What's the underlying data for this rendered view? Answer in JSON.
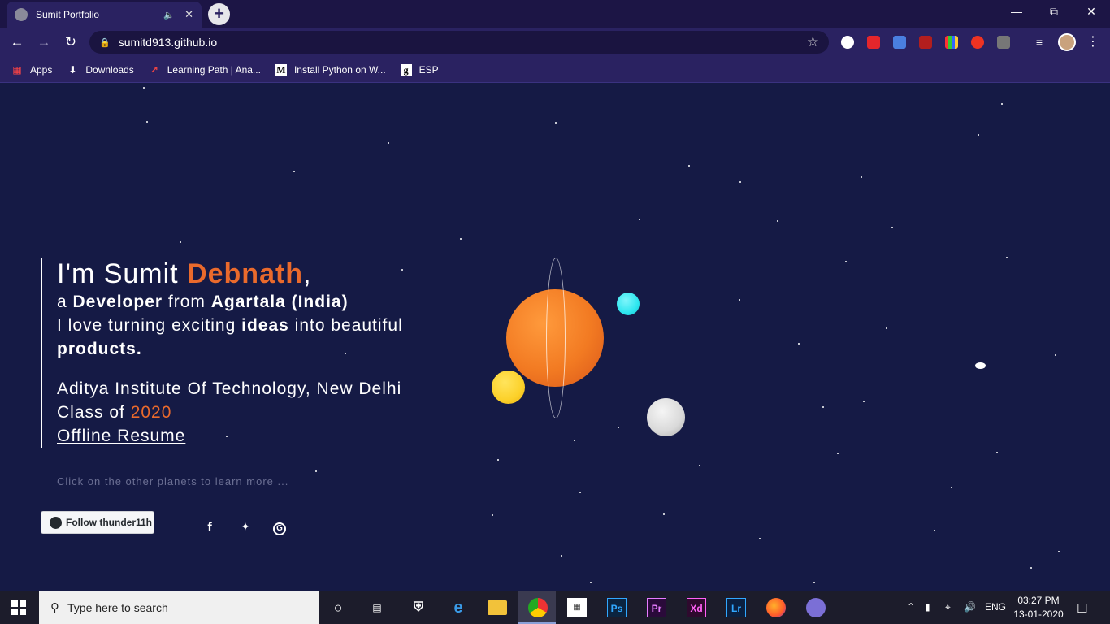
{
  "browser": {
    "tab_title": "Sumit Portfolio",
    "url": "sumitd913.github.io",
    "bookmarks": [
      {
        "label": "Apps"
      },
      {
        "label": "Downloads"
      },
      {
        "label": "Learning Path | Ana..."
      },
      {
        "label": "Install Python on W..."
      },
      {
        "label": "ESP"
      }
    ]
  },
  "intro": {
    "greeting": "I'm Sumit ",
    "surname": "Debnath",
    "comma": ",",
    "line2_a": "a ",
    "line2_role": "Developer",
    "line2_b": " from ",
    "line2_place": "Agartala (India)",
    "line3_a": "I love turning exciting ",
    "line3_ideas": "ideas",
    "line3_b": " into beautiful",
    "line4": "products.",
    "college": "Aditya Institute Of Technology, New Delhi",
    "class_label": "Class of ",
    "class_year": "2020",
    "resume_link": "Offline Resume"
  },
  "hint": "Click on the other planets to learn more ...",
  "follow_button": "Follow thunder11h",
  "social": [
    "f",
    "t",
    "G"
  ],
  "taskbar": {
    "search_placeholder": "Type here to search",
    "language": "ENG",
    "time": "03:27 PM",
    "date": "13-01-2020"
  },
  "colors": {
    "background": "#151a45",
    "accent": "#ea6a2c",
    "planet_main": "#f27a22",
    "planet_yellow": "#fcd12a",
    "planet_cyan": "#2ee6ef",
    "planet_grey": "#d9d9d9"
  }
}
